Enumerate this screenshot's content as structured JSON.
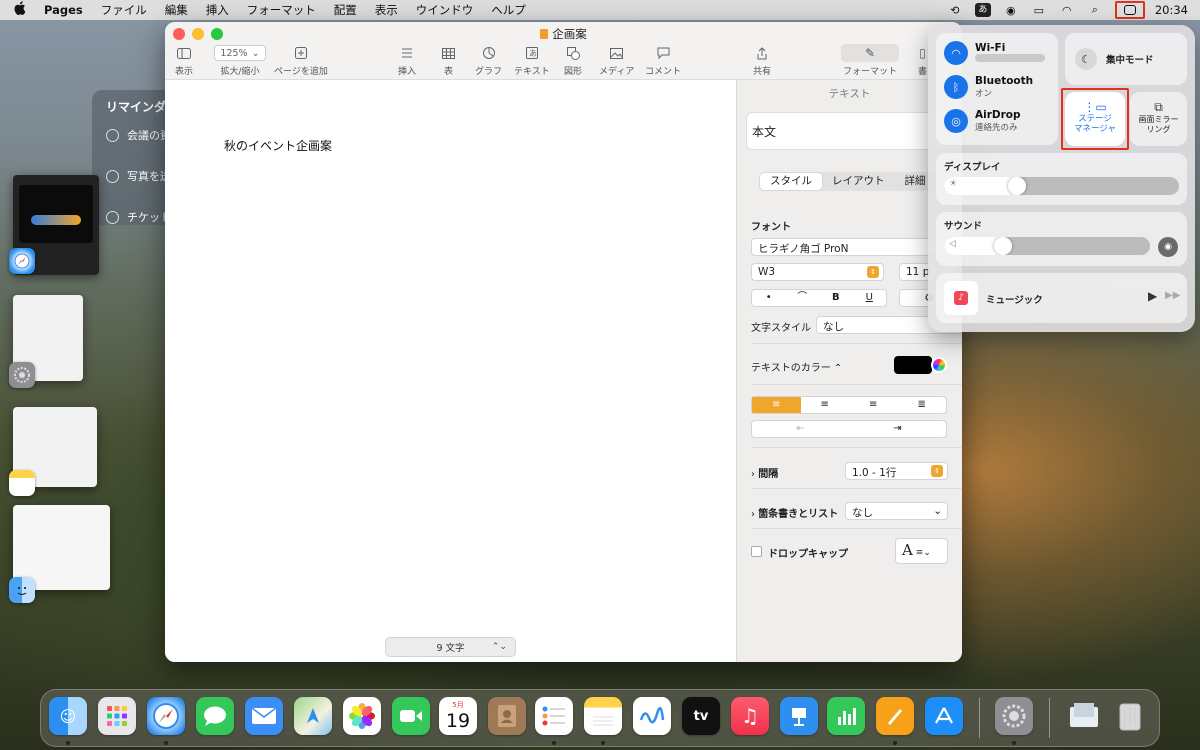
{
  "menubar": {
    "apple": "",
    "app_name": "Pages",
    "items": [
      "ファイル",
      "編集",
      "挿入",
      "フォーマット",
      "配置",
      "表示",
      "ウインドウ",
      "ヘルプ"
    ],
    "ime": "あ",
    "clock": "20:34"
  },
  "reminders": {
    "title": "リマインダー",
    "items": [
      "会議の資",
      "写真を送",
      "チケット"
    ]
  },
  "window": {
    "title": "企画案",
    "toolbar": {
      "view": "表示",
      "zoom_value": "125%",
      "zoom": "拡大/縮小",
      "add_page": "ページを追加",
      "insert": "挿入",
      "table": "表",
      "chart": "グラフ",
      "text": "テキスト",
      "shape": "図形",
      "media": "メディア",
      "comment": "コメント",
      "share": "共有",
      "format": "フォーマット",
      "document": "書"
    },
    "document_text": "秋のイベント企画案",
    "word_count": "9 文字"
  },
  "inspector": {
    "header": "テキスト",
    "paragraph_style": "本文",
    "tabs": [
      "スタイル",
      "レイアウト",
      "詳細"
    ],
    "font_label": "フォント",
    "font_name": "ヒラギノ角ゴ ProN",
    "font_weight": "W3",
    "font_size": "11 p",
    "char_buttons": [
      "•",
      "⌒",
      "B",
      "U",
      "⚙"
    ],
    "char_style_label": "文字スタイル",
    "char_style_value": "なし",
    "text_color_label": "テキストのカラー ⌃",
    "spacing_label": "間隔",
    "spacing_value": "1.0 - 1行",
    "bullets_label": "箇条書きとリスト",
    "bullets_value": "なし",
    "dropcap_label": "ドロップキャップ",
    "dropcap_preview": "A"
  },
  "control_center": {
    "wifi": {
      "label": "Wi-Fi"
    },
    "bluetooth": {
      "label": "Bluetooth",
      "status": "オン"
    },
    "airdrop": {
      "label": "AirDrop",
      "status": "連絡先のみ"
    },
    "focus": "集中モード",
    "stage_manager": "ステージ\nマネージャ",
    "screen_mirroring": "画面ミラー\nリング",
    "display": "ディスプレイ",
    "display_level": 0.35,
    "sound": "サウンド",
    "sound_level": 0.33,
    "music": "ミュージック"
  },
  "dock": {
    "calendar_month": "5月",
    "calendar_day": "19",
    "tv_label": "tv"
  },
  "colors": {
    "accent": "#f0a52c",
    "blue": "#1a73e8",
    "highlight_red": "#e0301e"
  }
}
